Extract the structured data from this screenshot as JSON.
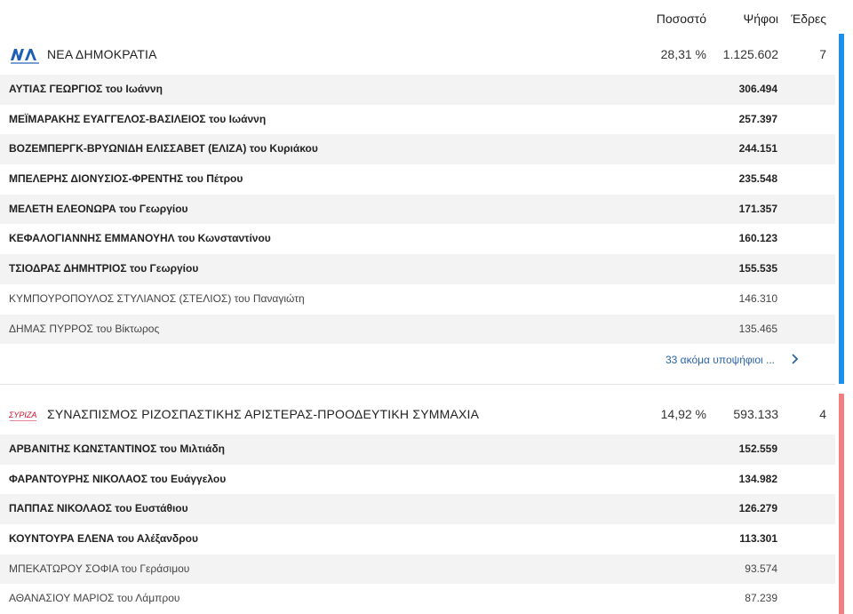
{
  "header": {
    "percent_label": "Ποσοστό",
    "votes_label": "Ψήφοι",
    "seats_label": "Έδρες"
  },
  "parties": [
    {
      "name": "ΝΕΑ ΔΗΜΟΚΡΑΤΙΑ",
      "logo_text": "ΝΔ",
      "logo_subtext": "ΝΕΑ ΔΗΜΟΚΡΑΤΙΑ",
      "percent": "28,31 %",
      "votes": "1.125.602",
      "seats": "7",
      "color": "#1e90e8",
      "candidates": [
        {
          "name": "ΑΥΤΙΑΣ ΓΕΩΡΓΙΟΣ του Ιωάννη",
          "votes": "306.494",
          "elected": true
        },
        {
          "name": "ΜΕΪΜΑΡΑΚΗΣ ΕΥΑΓΓΕΛΟΣ-ΒΑΣΙΛΕΙΟΣ του Ιωάννη",
          "votes": "257.397",
          "elected": true
        },
        {
          "name": "ΒΟΖΕΜΠΕΡΓΚ-ΒΡΥΩΝΙΔΗ ΕΛΙΣΣΑΒΕΤ (ΕΛΙΖΑ) του Κυριάκου",
          "votes": "244.151",
          "elected": true
        },
        {
          "name": "ΜΠΕΛΕΡΗΣ ΔΙΟΝΥΣΙΟΣ-ΦΡΕΝΤΗΣ του Πέτρου",
          "votes": "235.548",
          "elected": true
        },
        {
          "name": "ΜΕΛΕΤΗ ΕΛΕΟΝΩΡΑ του Γεωργίου",
          "votes": "171.357",
          "elected": true
        },
        {
          "name": "ΚΕΦΑΛΟΓΙΑΝΝΗΣ ΕΜΜΑΝΟΥΗΛ του Κωνσταντίνου",
          "votes": "160.123",
          "elected": true
        },
        {
          "name": "ΤΣΙΟΔΡΑΣ ΔΗΜΗΤΡΙΟΣ του Γεωργίου",
          "votes": "155.535",
          "elected": true
        },
        {
          "name": "ΚΥΜΠΟΥΡΟΠΟΥΛΟΣ ΣΤΥΛΙΑΝΟΣ (ΣΤΕΛΙΟΣ) του Παναγιώτη",
          "votes": "146.310",
          "elected": false
        },
        {
          "name": "ΔΗΜΑΣ ΠΥΡΡΟΣ του Βίκτωρος",
          "votes": "135.465",
          "elected": false
        }
      ],
      "more_label": "33 ακόμα υποψήφιοι ..."
    },
    {
      "name": "ΣΥΝΑΣΠΙΣΜΟΣ ΡΙΖΟΣΠΑΣΤΙΚΗΣ ΑΡΙΣΤΕΡΑΣ-ΠΡΟΟΔΕΥΤΙΚΗ ΣΥΜΜΑΧΙΑ",
      "logo_text": "ΣΥΡΙΖΑ",
      "percent": "14,92 %",
      "votes": "593.133",
      "seats": "4",
      "color": "#f08080",
      "candidates": [
        {
          "name": "ΑΡΒΑΝΙΤΗΣ ΚΩΝΣΤΑΝΤΙΝΟΣ του Μιλτιάδη",
          "votes": "152.559",
          "elected": true
        },
        {
          "name": "ΦΑΡΑΝΤΟΥΡΗΣ ΝΙΚΟΛΑΟΣ του Ευάγγελου",
          "votes": "134.982",
          "elected": true
        },
        {
          "name": "ΠΑΠΠΑΣ ΝΙΚΟΛΑΟΣ του Ευστάθιου",
          "votes": "126.279",
          "elected": true
        },
        {
          "name": "ΚΟΥΝΤΟΥΡΑ ΕΛΕΝΑ του Αλέξανδρου",
          "votes": "113.301",
          "elected": true
        },
        {
          "name": "ΜΠΕΚΑΤΩΡΟΥ ΣΟΦΙΑ του Γεράσιμου",
          "votes": "93.574",
          "elected": false
        },
        {
          "name": "ΑΘΑΝΑΣΙΟΥ ΜΑΡΙΟΣ του Λάμπρου",
          "votes": "87.239",
          "elected": false
        }
      ]
    }
  ]
}
